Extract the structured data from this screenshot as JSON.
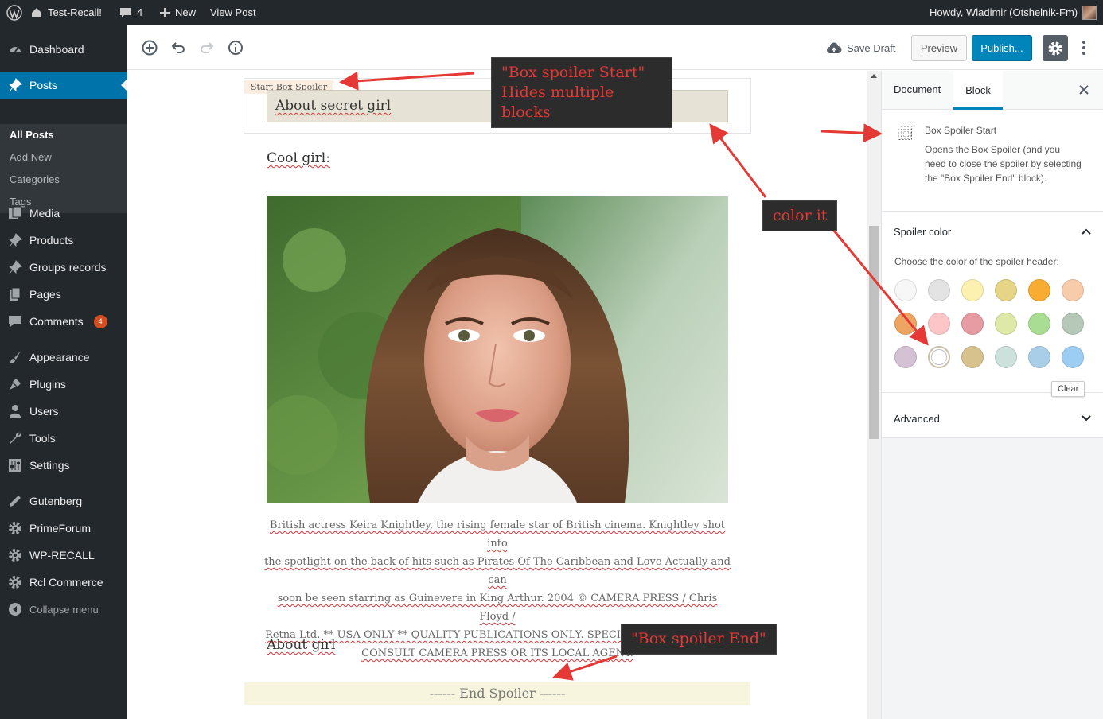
{
  "admin_bar": {
    "site_name": "Test-Recall!",
    "comment_count": "4",
    "new_label": "New",
    "view_post_label": "View Post",
    "howdy": "Howdy, Wladimir (Otshelnik-Fm)"
  },
  "sidebar": {
    "dashboard": "Dashboard",
    "posts": "Posts",
    "submenu": {
      "all_posts": "All Posts",
      "add_new": "Add New",
      "categories": "Categories",
      "tags": "Tags"
    },
    "media": "Media",
    "products": "Products",
    "groups_records": "Groups records",
    "pages": "Pages",
    "comments": "Comments",
    "comments_badge": "4",
    "appearance": "Appearance",
    "plugins": "Plugins",
    "users": "Users",
    "tools": "Tools",
    "settings": "Settings",
    "gutenberg": "Gutenberg",
    "primeforum": "PrimeForum",
    "wp_recall": "WP-RECALL",
    "rcl_commerce": "Rcl Commerce",
    "collapse": "Collapse menu"
  },
  "toolbar": {
    "save_draft": "Save Draft",
    "preview": "Preview",
    "publish": "Publish..."
  },
  "content": {
    "spoiler_tag": "Start Box Spoiler",
    "spoiler_title": "About secret girl",
    "cool_girl": "Cool girl:",
    "caption": {
      "line1": "British actress Keira Knightley, the rising female star of British cinema. Knightley shot into",
      "line2": "the spotlight on the back of hits such as Pirates Of The Caribbean and Love Actually and can",
      "line3": "soon be seen starring as Guinevere in King Arthur. 2004 © CAMERA PRESS / Chris Floyd /",
      "line4": "Retna Ltd. ** USA ONLY ** QUALITY PUBLICATIONS ONLY. SPECIAL PRICE APPLIES -",
      "line5": "CONSULT CAMERA PRESS OR ITS LOCAL AGENT."
    },
    "about_girl": "About girl",
    "end_spoiler": "------ End Spoiler ------"
  },
  "inspector": {
    "tab_document": "Document",
    "tab_block": "Block",
    "block_name": "Box Spoiler Start",
    "block_desc": "Opens the Box Spoiler (and you need to close the spoiler by selecting the \"Box Spoiler End\" block).",
    "spoiler_color_title": "Spoiler color",
    "spoiler_color_help": "Choose the color of the spoiler header:",
    "clear_tooltip": "Clear",
    "advanced": "Advanced",
    "swatches": [
      "#f7f7f7",
      "#e3e3e3",
      "#fdf1b0",
      "#e6d487",
      "#f8ac31",
      "#f8ccab",
      "#eea562",
      "#fcc6c8",
      "#e79ba2",
      "#dfe9a7",
      "#a9dd94",
      "#b6c9b8",
      "#d4c1d4",
      "#ffffff",
      "#d7c28d",
      "#cce0dc",
      "#a9cfe8",
      "#9ccdf2"
    ]
  },
  "annotations": {
    "note1_line1": "\"Box spoiler Start\"",
    "note1_line2": "Hides multiple blocks",
    "note2": "color it",
    "note3": "\"Box spoiler End\""
  }
}
